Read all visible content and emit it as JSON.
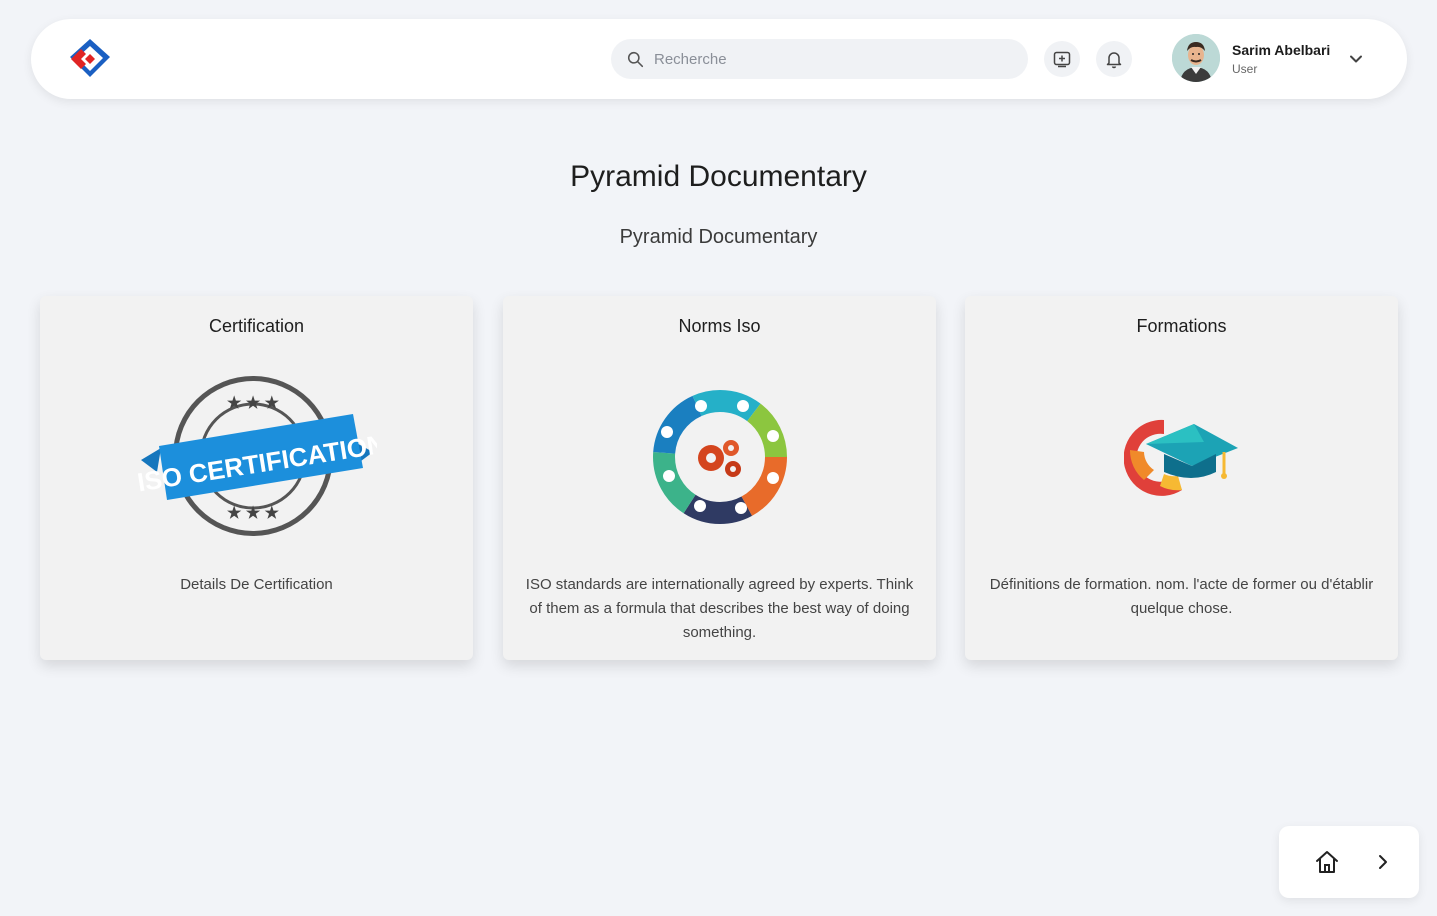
{
  "header": {
    "search": {
      "placeholder": "Recherche"
    },
    "user": {
      "name": "Sarim Abelbari",
      "role": "User"
    }
  },
  "main": {
    "title": "Pyramid Documentary",
    "subtitle": "Pyramid Documentary",
    "cards": [
      {
        "title": "Certification",
        "image_label": "ISO CERTIFICATION",
        "description": "Details De Certification"
      },
      {
        "title": "Norms Iso",
        "description": "ISO standards are internationally agreed by experts. Think of them as a formula that describes the best way of doing something."
      },
      {
        "title": "Formations",
        "description": "Définitions de formation. nom. l'acte de former ou d'établir quelque chose."
      }
    ]
  },
  "icons": {
    "logo": "app-logo",
    "search": "search-icon",
    "add": "add-document-icon",
    "notifications": "bell-icon",
    "menu": "chevron-down-icon",
    "home": "home-icon",
    "next": "chevron-right-icon"
  },
  "colors": {
    "background": "#f2f4f8",
    "brand_red": "#e02424",
    "brand_blue": "#1a5fc2",
    "badge_blue": "#1c8fdc"
  }
}
